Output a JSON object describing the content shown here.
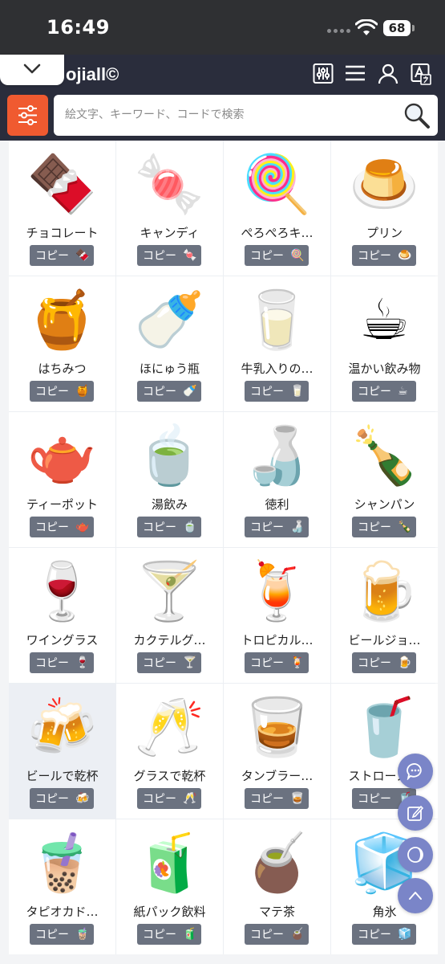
{
  "status_bar": {
    "time": "16:49",
    "battery": "68"
  },
  "header": {
    "logo": "ojiall©"
  },
  "search": {
    "placeholder": "絵文字、キーワード、コードで検索"
  },
  "copy_label": "コピー",
  "emojis": [
    {
      "char": "🍫",
      "name": "チョコレート"
    },
    {
      "char": "🍬",
      "name": "キャンディ"
    },
    {
      "char": "🍭",
      "name": "ぺろぺろキ…"
    },
    {
      "char": "🍮",
      "name": "プリン"
    },
    {
      "char": "🍯",
      "name": "はちみつ"
    },
    {
      "char": "🍼",
      "name": "ほにゅう瓶"
    },
    {
      "char": "🥛",
      "name": "牛乳入りの…"
    },
    {
      "char": "☕",
      "name": "温かい飲み物"
    },
    {
      "char": "🫖",
      "name": "ティーポット"
    },
    {
      "char": "🍵",
      "name": "湯飲み"
    },
    {
      "char": "🍶",
      "name": "徳利"
    },
    {
      "char": "🍾",
      "name": "シャンパン"
    },
    {
      "char": "🍷",
      "name": "ワイングラス"
    },
    {
      "char": "🍸",
      "name": "カクテルグ…"
    },
    {
      "char": "🍹",
      "name": "トロピカル…"
    },
    {
      "char": "🍺",
      "name": "ビールジョ…"
    },
    {
      "char": "🍻",
      "name": "ビールで乾杯"
    },
    {
      "char": "🥂",
      "name": "グラスで乾杯"
    },
    {
      "char": "🥃",
      "name": "タンブラー…"
    },
    {
      "char": "🥤",
      "name": "ストローカ…"
    },
    {
      "char": "🧋",
      "name": "タピオカド…"
    },
    {
      "char": "🧃",
      "name": "紙パック飲料"
    },
    {
      "char": "🧉",
      "name": "マテ茶"
    },
    {
      "char": "🧊",
      "name": "角氷"
    }
  ],
  "icons": [
    "chevron-down-icon",
    "settings-sliders-icon",
    "menu-icon",
    "user-icon",
    "translate-icon",
    "filter-icon",
    "search-icon",
    "chat-icon",
    "edit-icon",
    "dark-mode-icon",
    "scroll-top-icon"
  ],
  "colors": {
    "header_bg": "#2a2d3c",
    "filter_btn": "#f05a30",
    "copy_btn": "#6b7280",
    "fab": "#7a85c8"
  }
}
